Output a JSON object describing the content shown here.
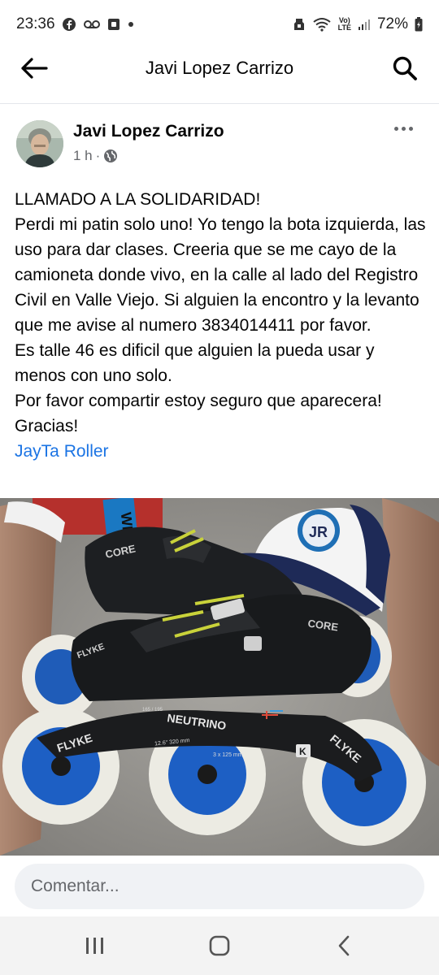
{
  "status_bar": {
    "time": "23:36",
    "battery": "72%",
    "network_label_top": "Vo)",
    "network_label_bottom": "LTE",
    "icons": [
      "facebook-icon",
      "voicemail-icon",
      "notification-icon",
      "dot-icon",
      "alarm-icon",
      "wifi-icon",
      "signal-icon",
      "battery-icon"
    ]
  },
  "header": {
    "title": "Javi Lopez Carrizo",
    "back_icon": "arrow-left-icon",
    "search_icon": "search-icon"
  },
  "post": {
    "author": "Javi Lopez Carrizo",
    "time_ago": "1 h",
    "separator": "·",
    "privacy_icon": "globe-icon",
    "more_icon": "more-horizontal-icon",
    "lines": [
      "LLAMADO A LA SOLIDARIDAD!",
      "Perdi mi patin solo uno! Yo tengo la bota izquierda, las uso para dar clases. Creeria que se me cayo de la camioneta donde vivo, en la calle al lado del Registro Civil en Valle Viejo. Si alguien la encontro y la levanto que me avise al numero 3834014411 por favor.",
      "Es talle 46 es dificil que alguien la pueda usar y menos con uno solo.",
      "Por favor compartir estoy seguro que aparecera! Gracias!"
    ],
    "page_link": "JayTa Roller",
    "photo": {
      "boot_brand_1": "CORE",
      "boot_brand_2": "CORE",
      "frame_brand_left": "FLYKE",
      "frame_brand_right": "FLYKE",
      "frame_model": "NEUTRINO",
      "frame_spec_1": "12.6\" 320 mm",
      "frame_spec_2": "3 x 125 mm",
      "frame_badge": "K",
      "frame_size": "165 / 195",
      "sock_text": "WE",
      "cap_logo": "JR"
    }
  },
  "comment": {
    "placeholder": "Comentar..."
  },
  "nav": {
    "recent_icon": "recent-apps-icon",
    "home_icon": "home-icon",
    "back_icon": "back-chevron-icon"
  }
}
